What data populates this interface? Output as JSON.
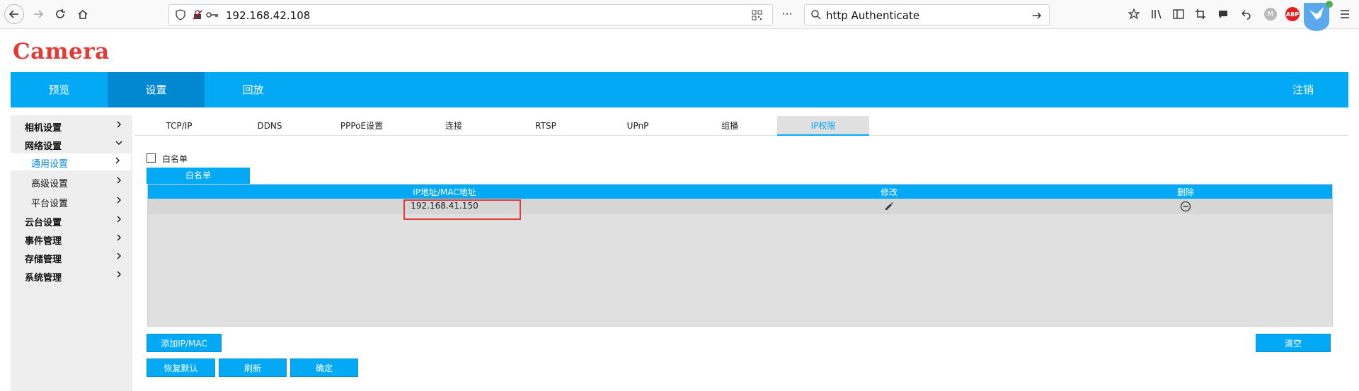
{
  "browser": {
    "url": "192.168.42.108",
    "search_value": "http  Authenticate"
  },
  "logo": "Camera",
  "nav": {
    "items": [
      "预览",
      "设置",
      "回放"
    ],
    "logout": "注销"
  },
  "sidebar": {
    "items": [
      {
        "label": "相机设置",
        "sub": false
      },
      {
        "label": "网络设置",
        "sub": false
      },
      {
        "label": "通用设置",
        "sub": true
      },
      {
        "label": "高级设置",
        "sub": true
      },
      {
        "label": "平台设置",
        "sub": true
      },
      {
        "label": "云台设置",
        "sub": false
      },
      {
        "label": "事件管理",
        "sub": false
      },
      {
        "label": "存储管理",
        "sub": false
      },
      {
        "label": "系统管理",
        "sub": false
      }
    ]
  },
  "tabs": [
    "TCP/IP",
    "DDNS",
    "PPPoE设置",
    "连接",
    "RTSP",
    "UPnP",
    "组播",
    "IP权限"
  ],
  "content": {
    "checkbox_label": "白名单",
    "list_tab": "白名单",
    "columns": [
      "IP地址/MAC地址",
      "修改",
      "删除"
    ],
    "rows": [
      {
        "address": "192.168.41.150"
      }
    ]
  },
  "buttons": {
    "add": "添加IP/MAC",
    "clear": "清空",
    "restore": "恢复默认",
    "refresh": "刷新",
    "confirm": "确定"
  },
  "colors": {
    "accent": "#03a9f4",
    "accent_dark": "#0288d1",
    "logo": "#e53935",
    "highlight": "#e53935"
  }
}
